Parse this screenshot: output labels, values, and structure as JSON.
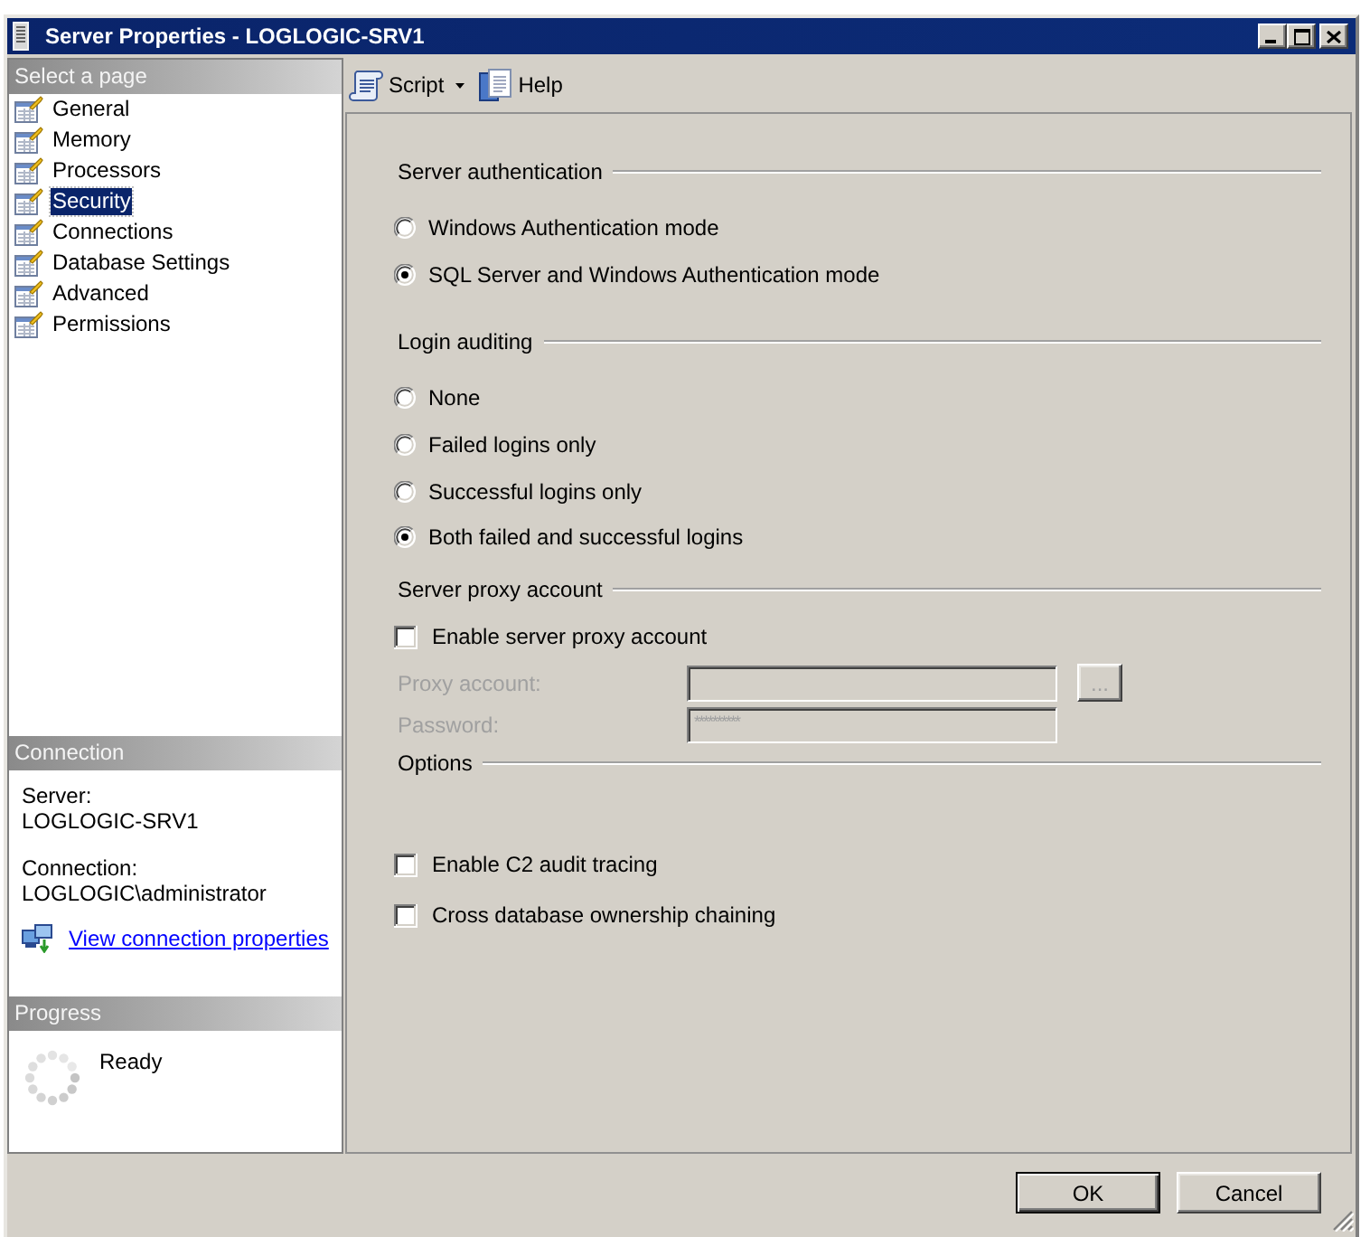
{
  "window": {
    "title": "Server Properties - LOGLOGIC-SRV1"
  },
  "sidebar": {
    "header": "Select a page",
    "items": [
      {
        "label": "General",
        "selected": false
      },
      {
        "label": "Memory",
        "selected": false
      },
      {
        "label": "Processors",
        "selected": false
      },
      {
        "label": "Security",
        "selected": true
      },
      {
        "label": "Connections",
        "selected": false
      },
      {
        "label": "Database Settings",
        "selected": false
      },
      {
        "label": "Advanced",
        "selected": false
      },
      {
        "label": "Permissions",
        "selected": false
      }
    ]
  },
  "connection": {
    "header": "Connection",
    "details": [
      {
        "label": "Server:",
        "value": "LOGLOGIC-SRV1"
      },
      {
        "label": "Connection:",
        "value": "LOGLOGIC\\administrator"
      }
    ],
    "link": "View connection properties"
  },
  "progress": {
    "header": "Progress",
    "status": "Ready"
  },
  "toolbar": {
    "script": "Script",
    "help": "Help"
  },
  "server_authentication": {
    "title": "Server authentication",
    "options": [
      {
        "label": "Windows Authentication mode",
        "selected": false
      },
      {
        "label": "SQL Server and Windows Authentication mode",
        "selected": true
      }
    ]
  },
  "login_auditing": {
    "title": "Login auditing",
    "options": [
      {
        "label": "None",
        "selected": false
      },
      {
        "label": "Failed logins only",
        "selected": false
      },
      {
        "label": "Successful logins only",
        "selected": false
      },
      {
        "label": "Both failed and successful logins",
        "selected": true
      }
    ]
  },
  "server_proxy": {
    "title": "Server proxy account",
    "enable": {
      "label": "Enable server proxy account",
      "checked": false
    },
    "fields": [
      {
        "kind": "browse",
        "label": "Proxy account:",
        "disabled": true,
        "browse_button": "..."
      },
      {
        "kind": "password",
        "label": "Password:",
        "disabled": true,
        "value": "**********"
      }
    ]
  },
  "options": {
    "title": "Options",
    "checkboxes": [
      {
        "label": "Enable C2 audit tracing",
        "checked": false
      },
      {
        "label": "Cross database ownership chaining",
        "checked": false
      }
    ]
  },
  "buttons": [
    {
      "label": "OK",
      "default": true
    },
    {
      "label": "Cancel",
      "default": false
    }
  ]
}
